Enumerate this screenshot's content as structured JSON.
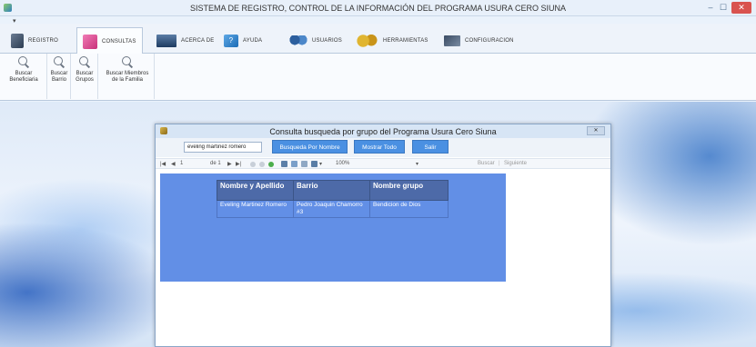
{
  "app": {
    "title": "SISTEMA DE REGISTRO, CONTROL DE LA INFORMACIÓN DEL PROGRAMA USURA CERO SIUNA",
    "controls": {
      "minimize": "–",
      "maximize": "☐",
      "close": "✕"
    },
    "qat_arrow": "▾"
  },
  "ribbon": {
    "tabs": [
      {
        "label": "REGISTRO",
        "icon": "registro-icon"
      },
      {
        "label": "CONSULTAS",
        "icon": "consultas-icon",
        "active": true
      },
      {
        "label": "ACERCA DE",
        "icon": "monitor-icon"
      },
      {
        "label": "AYUDA",
        "icon": "help-icon"
      },
      {
        "label": "USUARIOS",
        "icon": "users-icon"
      },
      {
        "label": "HERRAMIENTAS",
        "icon": "gears-icon"
      },
      {
        "label": "CONFIGURACION",
        "icon": "config-icon"
      }
    ],
    "buttons": [
      {
        "line1": "Buscar",
        "line2": "Beneficiaria"
      },
      {
        "line1": "Buscar",
        "line2": "Barrio"
      },
      {
        "line1": "Buscar",
        "line2": "Grupos"
      },
      {
        "line1": "Buscar Miembros",
        "line2": "de la Familia"
      }
    ]
  },
  "window": {
    "title": "Consulta busqueda por grupo del Programa Usura Cero Siuna",
    "close": "✕",
    "search_value": "eveling martinez romero",
    "btn_nombre": "Busqueda Por Nombre",
    "btn_todo": "Mostrar Todo",
    "btn_salir": "Salir",
    "viewer": {
      "first": "|◀",
      "prev": "◀",
      "page": "1",
      "of_pages": "de 1",
      "next": "▶",
      "last": "▶|",
      "zoom": "100%",
      "zoom_arrow": "▾",
      "find": "Buscar",
      "sep": "|",
      "next_find": "Siguiente"
    }
  },
  "report": {
    "headers": [
      "Nombre y Apellido",
      "Barrio",
      "Nombre grupo"
    ],
    "rows": [
      [
        "Eveling Martinez Romero",
        "Pedro Joaquin Chamorro #3",
        "Bendicion de Dios"
      ]
    ]
  }
}
